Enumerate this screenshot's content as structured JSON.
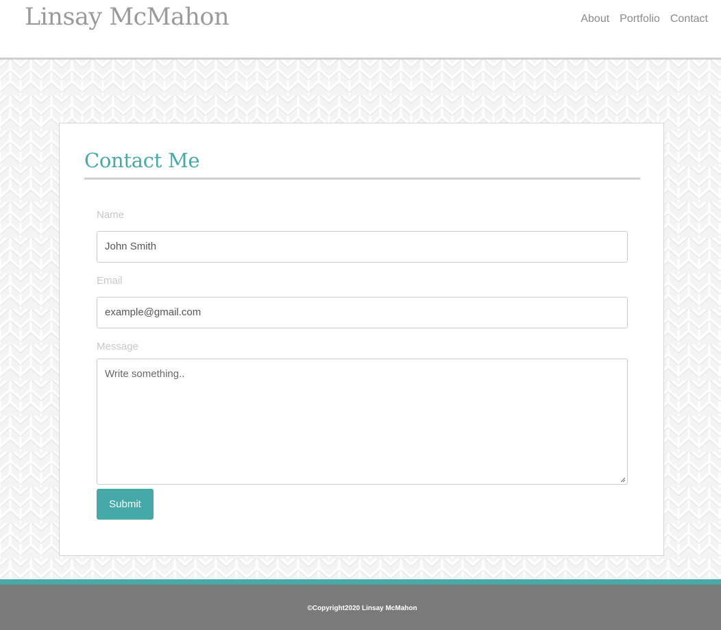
{
  "header": {
    "site_title": "Linsay McMahon",
    "nav": [
      {
        "label": "About"
      },
      {
        "label": "Portfolio"
      },
      {
        "label": "Contact"
      }
    ]
  },
  "contact": {
    "title": "Contact Me",
    "name_label": "Name",
    "name_value": "John Smith",
    "email_label": "Email",
    "email_value": "example@gmail.com",
    "message_label": "Message",
    "message_placeholder": "Write something..",
    "submit_label": "Submit"
  },
  "footer": {
    "copyright": "©Copyright2020 Linsay McMahon"
  },
  "colors": {
    "accent": "#45a9a8",
    "footer_bg": "#7a7a7a",
    "title_gray": "#9a9a9a"
  }
}
